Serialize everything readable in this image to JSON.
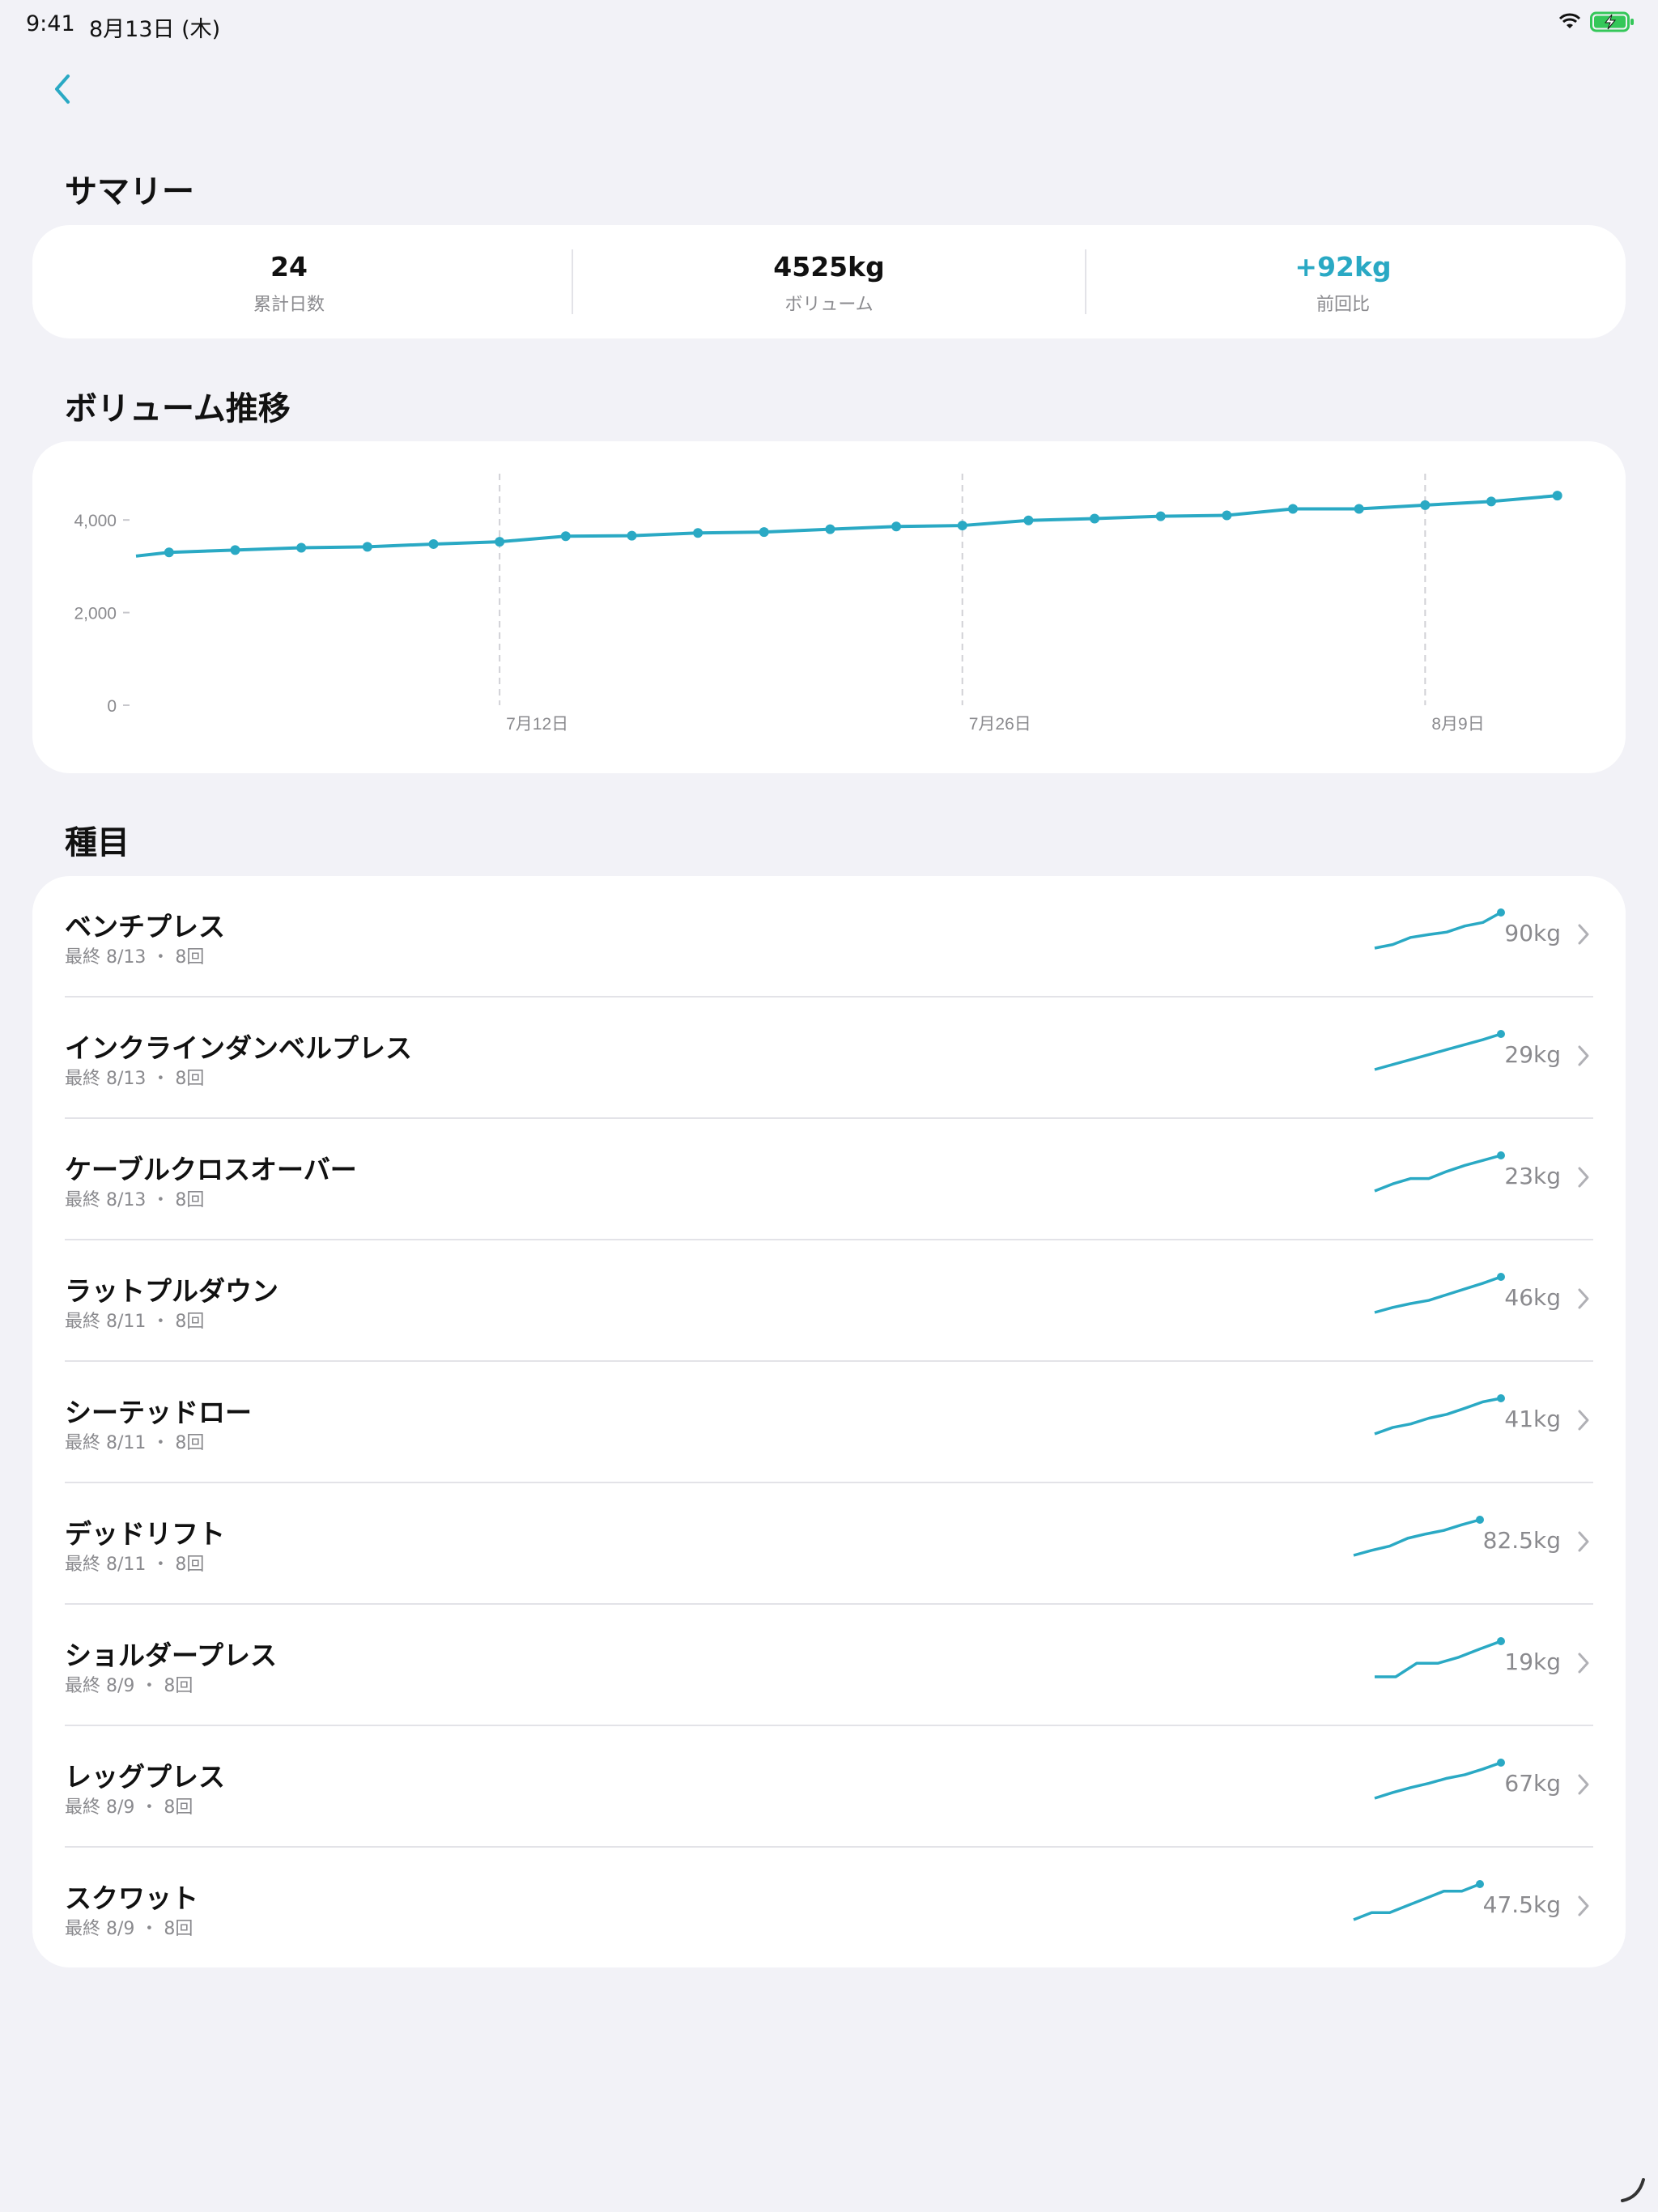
{
  "status": {
    "time": "9:41",
    "date": "8月13日 (木)",
    "wifi_icon": "wifi-icon",
    "battery_icon": "battery-charging-icon"
  },
  "nav": {
    "back_icon": "chevron-left-icon"
  },
  "colors": {
    "accent": "#2aa9c4",
    "background": "#f2f2f7",
    "card": "#ffffff",
    "secondary_text": "#8a8a8e"
  },
  "summary": {
    "title": "サマリー",
    "items": [
      {
        "value": "24",
        "label": "累計日数",
        "accent": false
      },
      {
        "value": "4525kg",
        "label": "ボリューム",
        "accent": false
      },
      {
        "value": "+92kg",
        "label": "前回比",
        "accent": true
      }
    ]
  },
  "volume": {
    "title": "ボリューム推移"
  },
  "chart_data": {
    "type": "line",
    "title": "",
    "xlabel": "",
    "ylabel": "",
    "ylim": [
      0,
      5000
    ],
    "y_ticks": [
      {
        "value": 0,
        "label": "0"
      },
      {
        "value": 2000,
        "label": "2,000"
      },
      {
        "value": 4000,
        "label": "4,000"
      }
    ],
    "x_ticks": [
      {
        "x": 5,
        "label": "7月12日"
      },
      {
        "x": 12,
        "label": "7月26日"
      },
      {
        "x": 19,
        "label": "8月9日"
      }
    ],
    "xlim": [
      -0.5,
      21.2
    ],
    "grid": "vertical-dashed-at-ticks",
    "series": [
      {
        "x": [
          0,
          1,
          2,
          3,
          4,
          5,
          6,
          7,
          8,
          9,
          10,
          11,
          12,
          13,
          14,
          15,
          16,
          17,
          18,
          19,
          20,
          21
        ],
        "values": [
          3300,
          3350,
          3400,
          3420,
          3480,
          3530,
          3650,
          3660,
          3720,
          3740,
          3800,
          3860,
          3880,
          3990,
          4030,
          4080,
          4100,
          4240,
          4240,
          4320,
          4400,
          4525
        ],
        "start_value": 3220
      }
    ]
  },
  "exercises": {
    "title": "種目",
    "items": [
      {
        "name": "ベンチプレス",
        "meta": "最終 8/13 ・ 8回",
        "weight": "90kg",
        "spark": [
          0,
          0.1,
          0.3,
          0.38,
          0.45,
          0.62,
          0.72,
          1.0
        ]
      },
      {
        "name": "インクラインダンベルプレス",
        "meta": "最終 8/13 ・ 8回",
        "weight": "29kg",
        "spark": [
          0,
          0.14,
          0.28,
          0.42,
          0.56,
          0.7,
          0.84,
          1.0
        ]
      },
      {
        "name": "ケーブルクロスオーバー",
        "meta": "最終 8/13 ・ 8回",
        "weight": "23kg",
        "spark": [
          0,
          0.2,
          0.35,
          0.35,
          0.55,
          0.72,
          0.86,
          1.0
        ]
      },
      {
        "name": "ラットプルダウン",
        "meta": "最終 8/11 ・ 8回",
        "weight": "46kg",
        "spark": [
          0,
          0.14,
          0.25,
          0.34,
          0.5,
          0.66,
          0.82,
          1.0
        ]
      },
      {
        "name": "シーテッドロー",
        "meta": "最終 8/11 ・ 8回",
        "weight": "41kg",
        "spark": [
          0,
          0.18,
          0.28,
          0.44,
          0.55,
          0.72,
          0.9,
          1.0
        ]
      },
      {
        "name": "デッドリフト",
        "meta": "最終 8/11 ・ 8回",
        "weight": "82.5kg",
        "spark": [
          0,
          0.14,
          0.26,
          0.48,
          0.6,
          0.7,
          0.86,
          1.0
        ]
      },
      {
        "name": "ショルダープレス",
        "meta": "最終 8/9 ・ 8回",
        "weight": "19kg",
        "spark": [
          0,
          0.0,
          0.38,
          0.38,
          0.55,
          0.78,
          1.0
        ]
      },
      {
        "name": "レッグプレス",
        "meta": "最終 8/9 ・ 8回",
        "weight": "67kg",
        "spark": [
          0,
          0.16,
          0.3,
          0.42,
          0.56,
          0.66,
          0.82,
          1.0
        ]
      },
      {
        "name": "スクワット",
        "meta": "最終 8/9 ・ 8回",
        "weight": "47.5kg",
        "spark": [
          0,
          0.2,
          0.2,
          0.4,
          0.6,
          0.8,
          0.8,
          1.0
        ]
      }
    ]
  }
}
